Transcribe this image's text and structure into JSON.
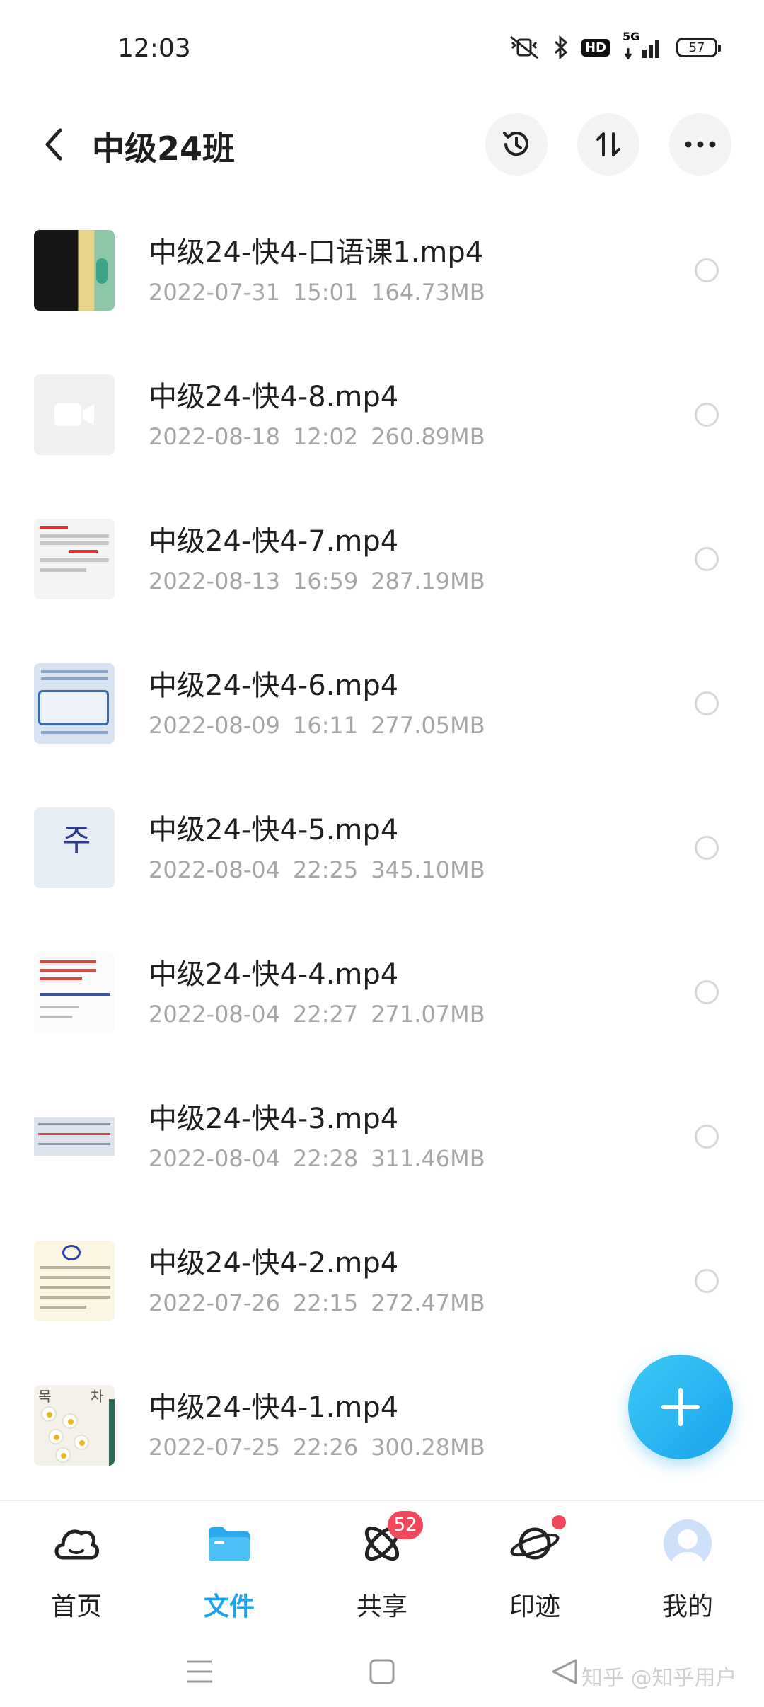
{
  "status_bar": {
    "time": "12:03",
    "network_label": "5G",
    "hd_label": "HD",
    "battery": "57"
  },
  "header": {
    "title": "中级24班"
  },
  "files": [
    {
      "name": "中级24-快4-口语课1.mp4",
      "date": "2022-07-31",
      "time": "15:01",
      "size": "164.73MB",
      "thumb": "phone-screen"
    },
    {
      "name": "中级24-快4-8.mp4",
      "date": "2022-08-18",
      "time": "12:02",
      "size": "260.89MB",
      "thumb": "video-placeholder"
    },
    {
      "name": "中级24-快4-7.mp4",
      "date": "2022-08-13",
      "time": "16:59",
      "size": "287.19MB",
      "thumb": "document"
    },
    {
      "name": "中级24-快4-6.mp4",
      "date": "2022-08-09",
      "time": "16:11",
      "size": "277.05MB",
      "thumb": "textbook-blue"
    },
    {
      "name": "中级24-快4-5.mp4",
      "date": "2022-08-04",
      "time": "22:25",
      "size": "345.10MB",
      "thumb": "handwriting"
    },
    {
      "name": "中级24-快4-4.mp4",
      "date": "2022-08-04",
      "time": "22:27",
      "size": "271.07MB",
      "thumb": "notes-red"
    },
    {
      "name": "中级24-快4-3.mp4",
      "date": "2022-08-04",
      "time": "22:28",
      "size": "311.46MB",
      "thumb": "textbook-strip"
    },
    {
      "name": "中级24-快4-2.mp4",
      "date": "2022-07-26",
      "time": "22:15",
      "size": "272.47MB",
      "thumb": "worksheet-yellow"
    },
    {
      "name": "中级24-快4-1.mp4",
      "date": "2022-07-25",
      "time": "22:26",
      "size": "300.28MB",
      "thumb": "flowers"
    }
  ],
  "thumb_text": {
    "glyph": "주",
    "flower_top_left": "목",
    "flower_top_right": "차"
  },
  "nav": [
    {
      "label": "首页",
      "icon": "cloud-icon"
    },
    {
      "label": "文件",
      "icon": "folder-icon",
      "active": true
    },
    {
      "label": "共享",
      "icon": "atom-icon",
      "badge": "52"
    },
    {
      "label": "印迹",
      "icon": "planet-icon",
      "dot": true
    },
    {
      "label": "我的",
      "icon": "avatar-icon"
    }
  ],
  "watermark": "知乎 @知乎用户",
  "colors": {
    "accent": "#20a3ef",
    "badge": "#f0485c",
    "meta_text": "#a6a6a6"
  }
}
